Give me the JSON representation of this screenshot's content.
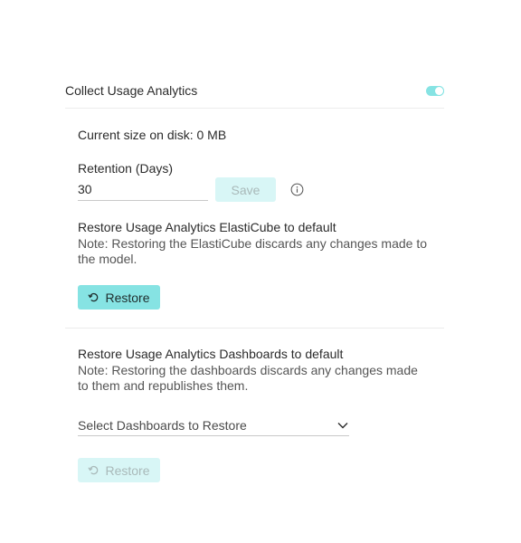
{
  "analytics": {
    "title": "Collect Usage Analytics",
    "enabled": true
  },
  "storage": {
    "size_label": "Current size on disk: 0 MB"
  },
  "retention": {
    "label": "Retention (Days)",
    "value": "30",
    "save_label": "Save"
  },
  "elasticube": {
    "title": "Restore Usage Analytics ElastiCube to default",
    "note": "Note: Restoring the ElastiCube discards any changes made to the model.",
    "restore_label": "Restore"
  },
  "dashboards": {
    "title": "Restore Usage Analytics Dashboards to default",
    "note": "Note: Restoring the dashboards discards any changes made to them and republishes them.",
    "select_placeholder": "Select Dashboards to Restore",
    "restore_label": "Restore"
  },
  "icons": {
    "toggle": "toggle-switch",
    "info": "info-icon",
    "restore": "restore-icon",
    "chevron": "chevron-down-icon"
  },
  "colors": {
    "accent": "#86e3e3",
    "accent_disabled": "#d8f6f6",
    "text": "#2b2b2b",
    "muted": "#555555"
  }
}
